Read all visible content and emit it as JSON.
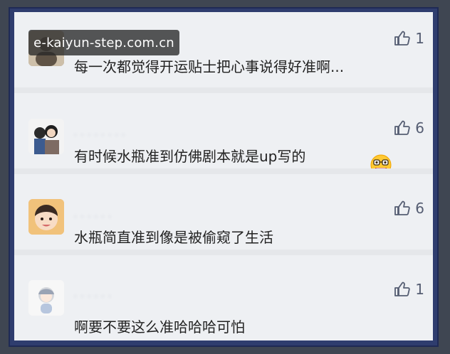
{
  "watermark": {
    "text": "e-kaiyun-step.com.cn"
  },
  "comments": [
    {
      "text": "每一次都觉得开运贴士把心事说得好准啊...",
      "likes": "1"
    },
    {
      "text": "有时候水瓶准到仿佛剧本就是up写的",
      "likes": "6",
      "emoji": "grinning-glasses-emoji"
    },
    {
      "text": "水瓶简直准到像是被偷窥了生活",
      "likes": "6"
    },
    {
      "text": "啊要不要这么准哈哈哈可怕",
      "likes": "1"
    }
  ],
  "icons": {
    "like": "thumbs-up-icon"
  },
  "colors": {
    "frame": "#2f3d6e",
    "background": "#eef0f3",
    "text": "#222222",
    "like": "#555d72"
  }
}
